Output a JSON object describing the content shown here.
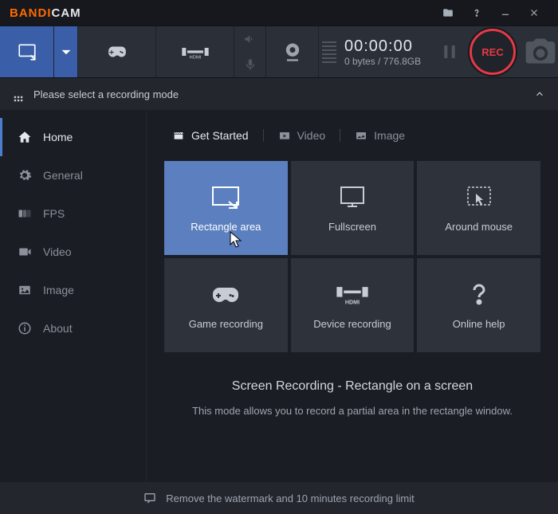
{
  "app": {
    "name1": "BANDI",
    "name2": "CAM"
  },
  "toolbar": {
    "timer": "00:00:00",
    "bytes": "0 bytes",
    "free": "776.8GB",
    "rec": "REC"
  },
  "mode_bar": {
    "text": "Please select a recording mode"
  },
  "sidebar": {
    "items": [
      {
        "label": "Home"
      },
      {
        "label": "General"
      },
      {
        "label": "FPS"
      },
      {
        "label": "Video"
      },
      {
        "label": "Image"
      },
      {
        "label": "About"
      }
    ]
  },
  "tabs": {
    "t0": "Get Started",
    "t1": "Video",
    "t2": "Image"
  },
  "tiles": {
    "t0": "Rectangle area",
    "t1": "Fullscreen",
    "t2": "Around mouse",
    "t3": "Game recording",
    "t4": "Device recording",
    "t5": "Online help"
  },
  "desc": {
    "title": "Screen Recording - Rectangle on a screen",
    "body": "This mode allows you to record a partial area in the rectangle window."
  },
  "footer": {
    "text": "Remove the watermark and 10 minutes recording limit"
  }
}
